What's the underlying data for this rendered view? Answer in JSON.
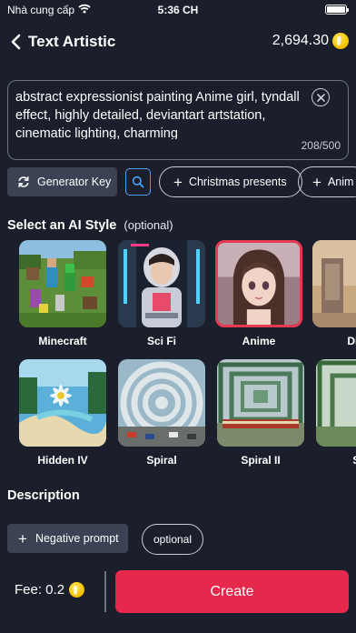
{
  "status_bar": {
    "carrier": "Nhà cung cấp",
    "time": "5:36 CH"
  },
  "header": {
    "title": "Text Artistic",
    "balance": "2,694.30"
  },
  "prompt": {
    "text": "abstract expressionist painting  Anime girl, tyndall effect, highly detailed, deviantart artstation, cinematic lighting, charming",
    "char_count": "208/500"
  },
  "toolbar": {
    "generator_key_label": "Generator Key",
    "tags": [
      "Christmas presents",
      "Anim"
    ]
  },
  "styles": {
    "title": "Select an AI Style",
    "optional": "(optional)",
    "row1": [
      {
        "label": "Minecraft",
        "selected": false
      },
      {
        "label": "Sci Fi",
        "selected": false
      },
      {
        "label": "Anime",
        "selected": true
      },
      {
        "label": "Dig",
        "selected": false
      }
    ],
    "row2": [
      {
        "label": "Hidden IV",
        "selected": false
      },
      {
        "label": "Spiral",
        "selected": false
      },
      {
        "label": "Spiral II",
        "selected": false
      },
      {
        "label": "Sp",
        "selected": false
      }
    ]
  },
  "description": {
    "title": "Description",
    "negative_prompt_label": "Negative prompt",
    "optional_label": "optional"
  },
  "footer": {
    "fee_label": "Fee: 0.2",
    "create_label": "Create"
  },
  "colors": {
    "background": "#1b1f2b",
    "accent": "#e5284c",
    "selected_border": "#e63a52",
    "link": "#4da1ff"
  }
}
